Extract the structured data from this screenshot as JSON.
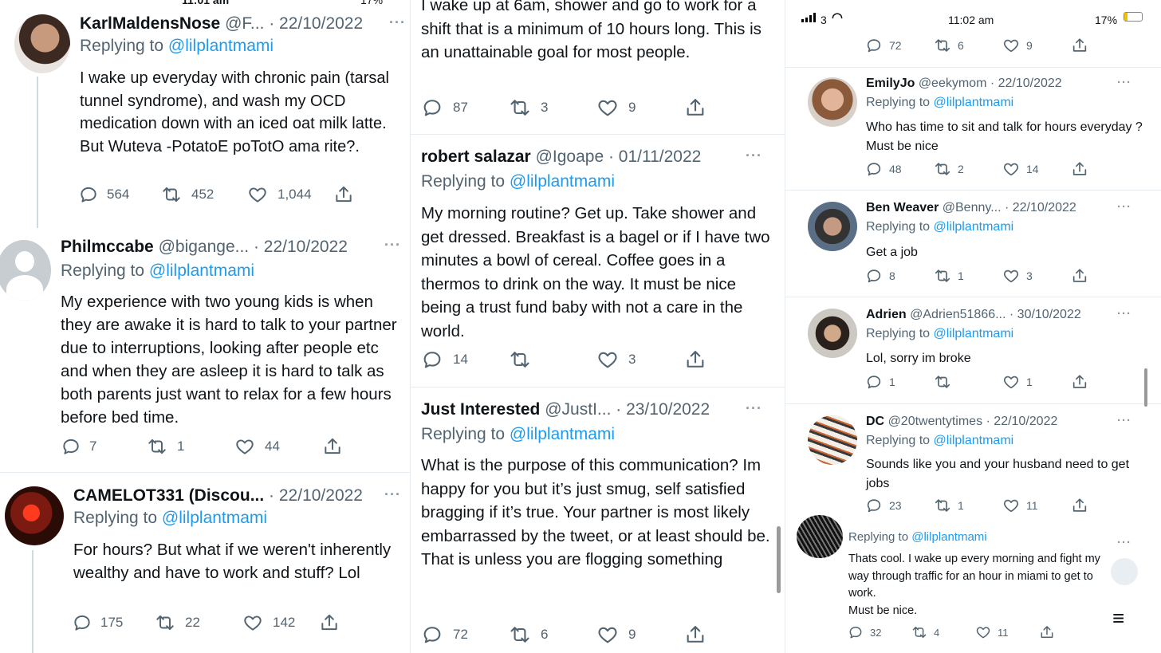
{
  "panel1": {
    "status_time": "11:01 am",
    "status_battery": "17%",
    "tweets": [
      {
        "name": "KarlMaldensNose",
        "handle": "@F... · 22/10/2022",
        "replying_prefix": "Replying to ",
        "mention": "@lilplantmami",
        "body": "I wake up everyday with chronic pain (tarsal tunnel syndrome), and wash my OCD medication down with an iced oat milk  latte.  But Wuteva  -PotatoE poTotO ama rite?.",
        "replies": "564",
        "retweets": "452",
        "likes": "1,044"
      },
      {
        "name": "Philmccabe",
        "handle": "@bigange... · 22/10/2022",
        "replying_prefix": "Replying to ",
        "mention": "@lilplantmami",
        "body": "My experience with two young kids is when they are awake it is hard to talk to your partner due to interruptions, looking after people etc and when they are asleep it is hard to talk as both parents just want to relax for a few hours before bed time.",
        "replies": "7",
        "retweets": "1",
        "likes": "44"
      },
      {
        "name": "CAMELOT331 (Discou...",
        "handle": "· 22/10/2022",
        "replying_prefix": "Replying to ",
        "mention": "@lilplantmami",
        "body": "For hours? But what if we weren't inherently wealthy and have to work and stuff? Lol",
        "replies": "175",
        "retweets": "22",
        "likes": "142"
      }
    ]
  },
  "panel2": {
    "top_body": "I wake up at 6am, shower and go to work for a shift that is a minimum of 10 hours long. This is an unattainable goal for most people.",
    "top_replies": "87",
    "top_retweets": "3",
    "top_likes": "9",
    "tweets": [
      {
        "name": "robert salazar",
        "handle": "@Igoape · 01/11/2022",
        "replying_prefix": "Replying to ",
        "mention": "@lilplantmami",
        "body": "My morning routine? Get up. Take shower and get dressed. Breakfast is a bagel or if I have two minutes a bowl of cereal. Coffee goes in a thermos to drink on the way. It must be nice being a trust fund baby with not a care in  the world.",
        "replies": "14",
        "retweets": "",
        "likes": "3"
      },
      {
        "name": "Just Interested",
        "handle": "@JustI... · 23/10/2022",
        "replying_prefix": "Replying to ",
        "mention": "@lilplantmami",
        "body": "What is the purpose of this communication? Im happy for you but it’s just smug, self satisfied bragging if it’s true. Your partner is most likely embarrassed by the tweet, or at least should be. That is unless you are flogging something",
        "replies": "72",
        "retweets": "6",
        "likes": "9"
      }
    ]
  },
  "panel3": {
    "status_time": "11:02 am",
    "status_carrier": "3",
    "status_battery": "17%",
    "top_replies": "72",
    "top_retweets": "6",
    "top_likes": "9",
    "tweets": [
      {
        "name": "EmilyJo",
        "handle": "@eekymom · 22/10/2022",
        "replying_prefix": "Replying to ",
        "mention": "@lilplantmami",
        "body": "Who has time to sit and talk for hours everyday ? Must be nice",
        "replies": "48",
        "retweets": "2",
        "likes": "14"
      },
      {
        "name": "Ben Weaver",
        "handle": "@Benny... · 22/10/2022",
        "replying_prefix": "Replying to ",
        "mention": "@lilplantmami",
        "body": "Get a job",
        "replies": "8",
        "retweets": "1",
        "likes": "3"
      },
      {
        "name": "Adrien",
        "handle": "@Adrien51866... · 30/10/2022",
        "replying_prefix": "Replying to ",
        "mention": "@lilplantmami",
        "body": "Lol, sorry im broke",
        "replies": "1",
        "retweets": "",
        "likes": "1"
      },
      {
        "name": "DC",
        "handle": "@20twentytimes · 22/10/2022",
        "replying_prefix": "Replying to ",
        "mention": "@lilplantmami",
        "body": "Sounds like you and your husband need to get jobs",
        "replies": "23",
        "retweets": "1",
        "likes": "11"
      },
      {
        "name": "",
        "handle": "",
        "replying_prefix": "Replying to ",
        "mention": "@lilplantmami",
        "body": "Thats cool. I wake up every morning and fight my way through traffic for an hour in miami to get to work.\nMust be nice.",
        "replies": "32",
        "retweets": "4",
        "likes": "11"
      }
    ]
  },
  "colors": {
    "accent": "#1d9bf0",
    "muted": "#536471",
    "text": "#0f1419",
    "separator": "#e6ecf0"
  },
  "icons": [
    "reply-icon",
    "retweet-icon",
    "like-icon",
    "share-icon",
    "more-icon",
    "signal-icon",
    "wifi-icon",
    "battery-icon"
  ]
}
